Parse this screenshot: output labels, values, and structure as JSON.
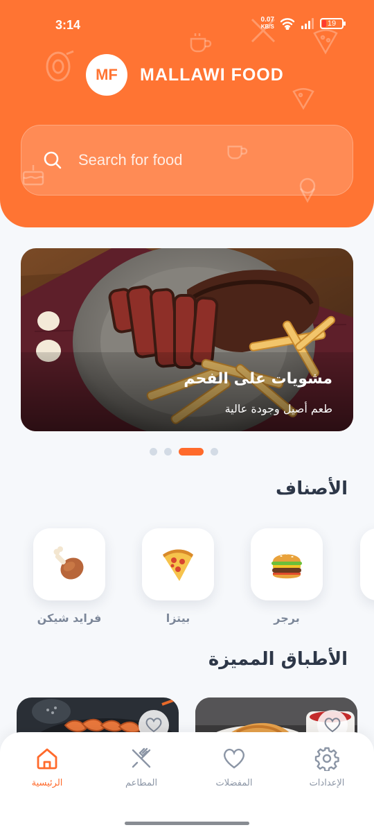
{
  "status_bar": {
    "time": "3:14",
    "net_speed_value": "0.07",
    "net_speed_unit": "KB/S",
    "battery_level": "19",
    "battery_color": "#ff3b30"
  },
  "brand": {
    "logo_text": "MF",
    "name": "MALLAWI FOOD"
  },
  "search": {
    "placeholder": "Search for food",
    "value": ""
  },
  "banner": {
    "title": "مشويات على الفحم",
    "subtitle": "طعم أصيل وجودة عالية",
    "slides_count": 4,
    "active_slide": 3
  },
  "categories": {
    "title": "الأصناف",
    "items": [
      {
        "label": "برجر",
        "icon": "burger-icon"
      },
      {
        "label": "بيتزا",
        "icon": "pizza-icon"
      },
      {
        "label": "فرايد شيكن",
        "icon": "chicken-leg-icon"
      }
    ]
  },
  "featured": {
    "title": "الأطباق المميزة"
  },
  "nav": {
    "home": "الرئيسية",
    "restaurants": "المطاعم",
    "favorites": "المفضلات",
    "settings": "الإعدادات",
    "active": "home"
  },
  "colors": {
    "accent": "#ff7433",
    "active_nav": "#ff6a2b",
    "background": "#f6f8fb"
  }
}
